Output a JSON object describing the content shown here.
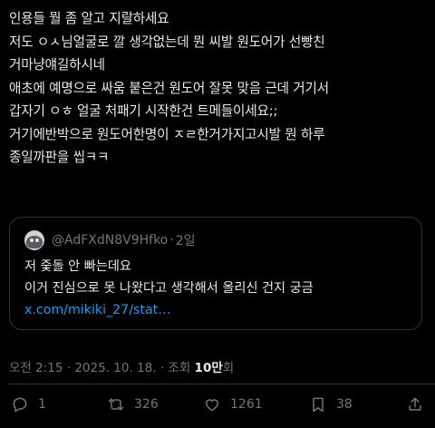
{
  "post": {
    "lines": [
      "인용들 뭘 좀 알고 지랄하세요",
      "저도 ㅇㅅ님얼굴로 깔 생각없는데 뭔 씨발 원도어가 선빵친",
      "거마냥얘길하시네",
      "애초에 예명으로 싸움 붙은건 원도어 잘못 맞음 근데 거기서",
      "갑자기 ㅇㅎ 얼굴 처패기 시작한건 트메들이세요;;",
      "거기에반박으로 원도어한명이 ㅈㄹ한거가지고시발 뭔 하루",
      "종일까판을 씹ㅋㅋ"
    ]
  },
  "quote": {
    "handle": "@AdFXdN8V9Hfko",
    "separator": "·",
    "time": "2일",
    "lines": [
      "저 줒돌 안 빠는데요",
      "이거 진심으로 못 나왔다고 생각해서 올리신 건지 궁금"
    ],
    "link": "x.com/mikiki_27/stat…"
  },
  "meta": {
    "time": "오전 2:15",
    "date": "2025. 10. 18.",
    "views_label": "조회",
    "views_count": "10만",
    "views_suffix": "회"
  },
  "actions": {
    "reply_count": "1",
    "retweet_count": "326",
    "like_count": "1261",
    "bookmark_count": "38"
  },
  "icons": [
    "reply-icon",
    "retweet-icon",
    "like-icon",
    "bookmark-icon",
    "share-icon"
  ],
  "colors": {
    "background": "#000000",
    "text": "#e7e9ea",
    "muted": "#71767b",
    "link": "#1d9bf0",
    "border": "#2f3336"
  }
}
